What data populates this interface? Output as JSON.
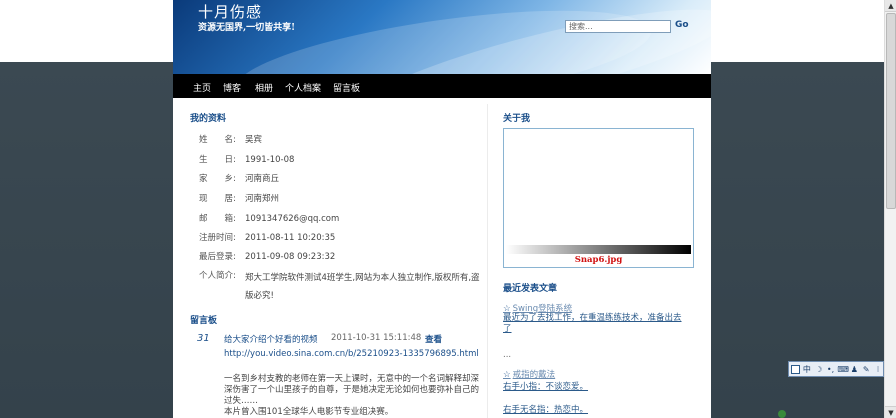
{
  "site": {
    "title": "十月伤感",
    "subtitle": "资源无国界,一切皆共享!"
  },
  "search": {
    "placeholder": "搜索...",
    "go_label": "Go"
  },
  "nav": {
    "items": [
      "主页",
      "博客",
      "相册",
      "个人档案",
      "留言板"
    ]
  },
  "profile": {
    "title": "我的资料",
    "rows": [
      {
        "label": "姓　　名:",
        "value": "吴宾"
      },
      {
        "label": "生　　日:",
        "value": "1991-10-08"
      },
      {
        "label": "家　　乡:",
        "value": "河南商丘"
      },
      {
        "label": "现　　居:",
        "value": "河南郑州"
      },
      {
        "label": "邮　　箱:",
        "value": "1091347626@qq.com"
      },
      {
        "label": "注册时间:",
        "value": "2011-08-11 10:20:35"
      },
      {
        "label": "最后登录:",
        "value": "2011-09-08 09:23:32"
      }
    ],
    "intro_label": "个人简介:",
    "intro_value": "郑大工学院软件测试4班学生,网站为本人独立制作,版权所有,盗版必究!"
  },
  "guestbook": {
    "title": "留言板",
    "entry": {
      "number": "31",
      "title": "给大家介绍个好看的视频",
      "date": "2011-10-31 15:11:48",
      "view": "查看",
      "url": "http://you.video.sina.com.cn/b/25210923-1335796895.html",
      "body": "一名到乡村支教的老师在第一天上课时，无意中的一个名词解释却深深伤害了一个山里孩子的自尊，于是她决定无论如何也要弥补自己的过失……",
      "body2": "本片曾入围101全球华人电影节专业组决赛。"
    }
  },
  "about": {
    "title": "关于我",
    "image_caption": "Snap6.jpg"
  },
  "recent": {
    "title": "最近发表文章",
    "articles": [
      {
        "title": "Swing登陆系统",
        "summary": "最近为了去找工作，在重温练练技术，准备出去了"
      },
      {
        "ellipsis": "..."
      },
      {
        "title": "戒指的戴法",
        "summary": "右手小指：不谈恋爱。"
      },
      {
        "summary": "右手无名指：热恋中。"
      }
    ]
  },
  "ime": {
    "mode": "中"
  },
  "colors": {
    "nav_bg": "#000000",
    "link": "#1b4f8a",
    "caption": "#d01010",
    "page_bg": "#3b4952"
  }
}
